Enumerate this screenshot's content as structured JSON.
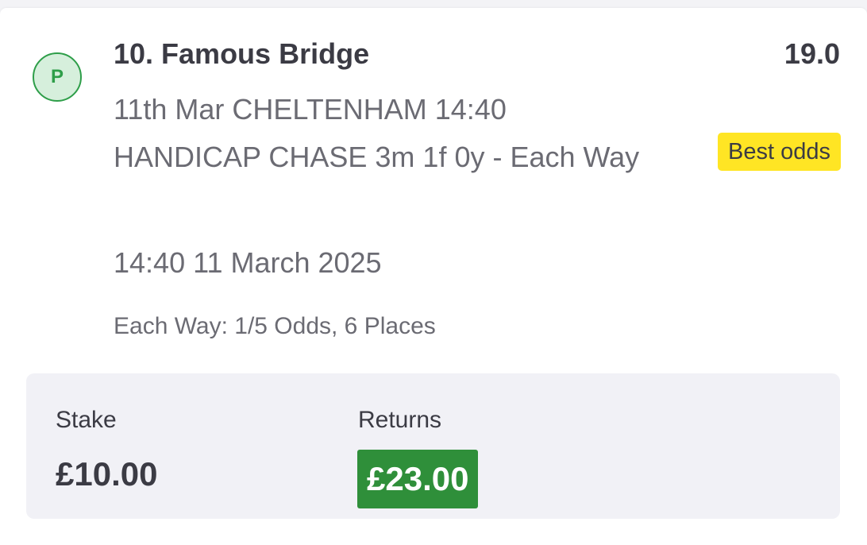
{
  "status_badge": {
    "letter": "P",
    "color": "#2e9e49",
    "background": "#d6efdc"
  },
  "selection": {
    "title": "10. Famous Bridge",
    "odds": "19.0",
    "description": "11th Mar CHELTENHAM 14:40 HANDICAP CHASE 3m 1f 0y - Each Way",
    "best_odds_label": "Best odds",
    "best_odds_color": "#ffe524",
    "datetime": "14:40 11 March 2025",
    "each_way_terms": "Each Way: 1/5 Odds, 6 Places"
  },
  "bet": {
    "stake_label": "Stake",
    "stake_value": "£10.00",
    "returns_label": "Returns",
    "returns_value": "£23.00",
    "returns_color": "#2f8f3a"
  }
}
